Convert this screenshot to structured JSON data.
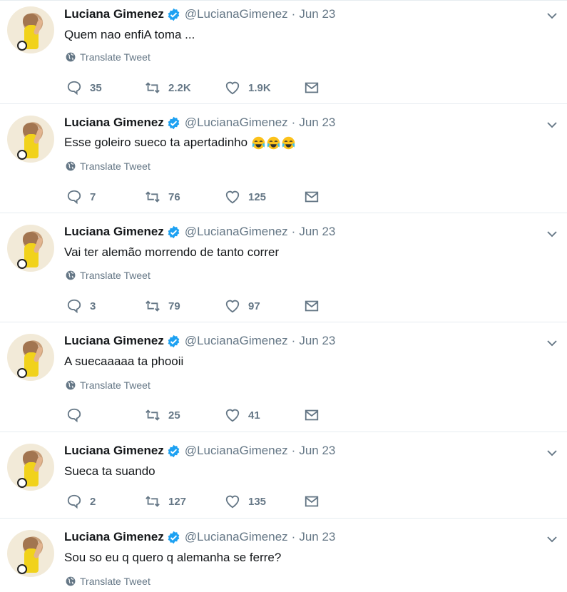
{
  "tweets": [
    {
      "name": "Luciana Gimenez",
      "handle": "@LucianaGimenez",
      "dot": "·",
      "date": "Jun 23",
      "text": "Quem nao enfiA toma ...",
      "emoji_count": 0,
      "translate": "Translate Tweet",
      "replies": "35",
      "retweets": "2.2K",
      "likes": "1.9K"
    },
    {
      "name": "Luciana Gimenez",
      "handle": "@LucianaGimenez",
      "dot": "·",
      "date": "Jun 23",
      "text": "Esse goleiro sueco ta apertadinho ",
      "emoji_count": 3,
      "translate": "Translate Tweet",
      "replies": "7",
      "retweets": "76",
      "likes": "125"
    },
    {
      "name": "Luciana Gimenez",
      "handle": "@LucianaGimenez",
      "dot": "·",
      "date": "Jun 23",
      "text": "Vai ter alemão morrendo de tanto correr",
      "emoji_count": 0,
      "translate": "Translate Tweet",
      "replies": "3",
      "retweets": "79",
      "likes": "97"
    },
    {
      "name": "Luciana Gimenez",
      "handle": "@LucianaGimenez",
      "dot": "·",
      "date": "Jun 23",
      "text": "A suecaaaaa ta phooii",
      "emoji_count": 0,
      "translate": "Translate Tweet",
      "replies": "",
      "retweets": "25",
      "likes": "41"
    },
    {
      "name": "Luciana Gimenez",
      "handle": "@LucianaGimenez",
      "dot": "·",
      "date": "Jun 23",
      "text": "Sueca ta suando",
      "emoji_count": 0,
      "translate": "",
      "replies": "2",
      "retweets": "127",
      "likes": "135"
    },
    {
      "name": "Luciana Gimenez",
      "handle": "@LucianaGimenez",
      "dot": "·",
      "date": "Jun 23",
      "text": "Sou so eu q quero q alemanha se ferre?",
      "emoji_count": 0,
      "translate": "Translate Tweet",
      "replies": "",
      "retweets": "",
      "likes": ""
    }
  ],
  "icons": {
    "reply": "reply-icon",
    "retweet": "retweet-icon",
    "like": "heart-icon",
    "dm": "envelope-icon",
    "verified": "verified-badge-icon",
    "caret": "chevron-down-icon",
    "globe": "globe-icon",
    "emoji": "face-with-tears-of-joy-icon"
  },
  "colors": {
    "verified": "#1da1f2",
    "secondary_text": "#657786",
    "divider": "#e6ecf0"
  }
}
